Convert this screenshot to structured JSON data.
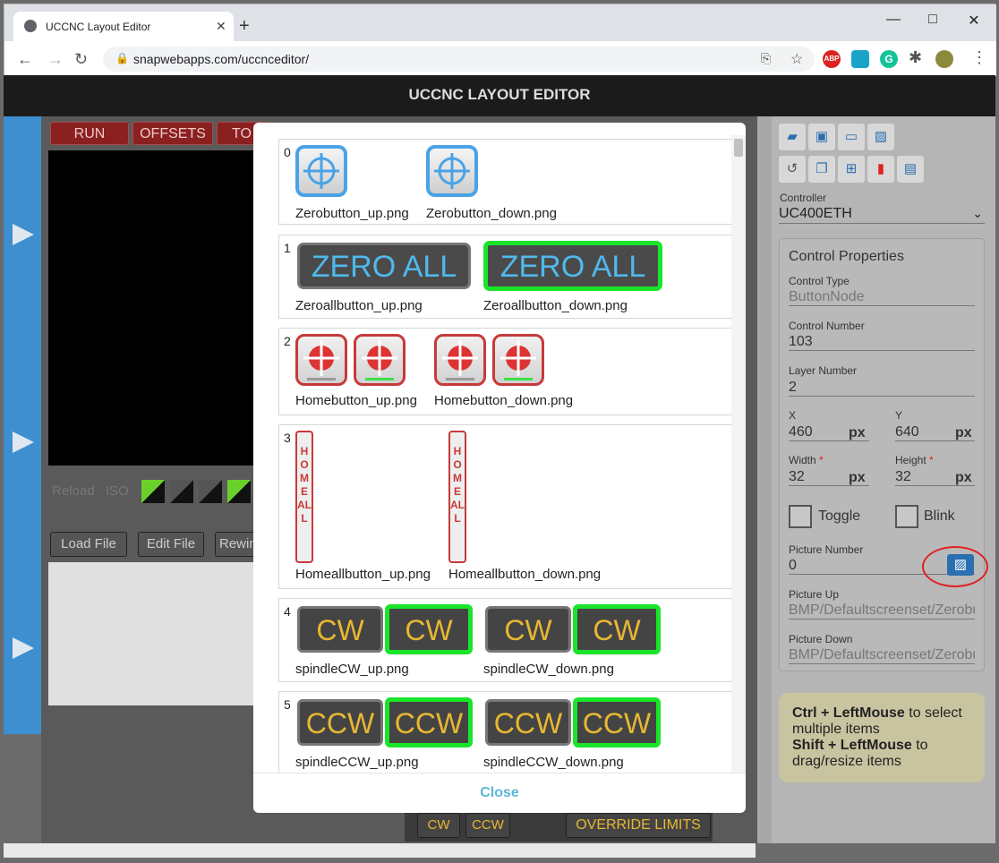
{
  "browser": {
    "tab_title": "UCCNC Layout Editor",
    "url": "snapwebapps.com/uccnceditor/",
    "minimize": "—",
    "maximize": "□",
    "close": "✕",
    "tab_close": "✕",
    "new_tab": "+",
    "ext_abp": "ABP",
    "ext_g": "G"
  },
  "app": {
    "title": "UCCNC LAYOUT EDITOR"
  },
  "toolbar": {
    "run": "RUN",
    "offsets": "OFFSETS",
    "to": "TO",
    "load_file": "Load File",
    "edit_file": "Edit File",
    "rewind": "Rewin",
    "reload": "Reload",
    "iso": "ISO"
  },
  "bottom": {
    "cw": "CW",
    "ccw": "CCW",
    "override": "OVERRIDE LIMITS"
  },
  "panel": {
    "controller_label": "Controller",
    "controller_value": "UC400ETH",
    "section_title": "Control Properties",
    "control_type_label": "Control Type",
    "control_type_value": "ButtonNode",
    "control_number_label": "Control Number",
    "control_number_value": "103",
    "layer_number_label": "Layer Number",
    "layer_number_value": "2",
    "x_label": "X",
    "x_value": "460",
    "y_label": "Y",
    "y_value": "640",
    "width_label": "Width",
    "width_value": "32",
    "height_label": "Height",
    "height_value": "32",
    "unit": "px",
    "required": "*",
    "toggle_label": "Toggle",
    "blink_label": "Blink",
    "picture_number_label": "Picture Number",
    "picture_number_value": "0",
    "picture_up_label": "Picture Up",
    "picture_up_value": "BMP/Defaultscreenset/Zerobu",
    "picture_down_label": "Picture Down",
    "picture_down_value": "BMP/Defaultscreenset/Zerobu"
  },
  "hint": {
    "k1": "Ctrl + LeftMouse",
    "t1": " to select multiple items",
    "k2": "Shift + LeftMouse",
    "t2": " to drag/resize items"
  },
  "modal": {
    "close": "Close",
    "items": [
      {
        "index": "0",
        "up": "Zerobutton_up.png",
        "down": "Zerobutton_down.png"
      },
      {
        "index": "1",
        "up": "Zeroallbutton_up.png",
        "down": "Zeroallbutton_down.png",
        "label": "ZERO ALL"
      },
      {
        "index": "2",
        "up": "Homebutton_up.png",
        "down": "Homebutton_down.png"
      },
      {
        "index": "3",
        "up": "Homeallbutton_up.png",
        "down": "Homeallbutton_down.png",
        "label": "HOME ALL"
      },
      {
        "index": "4",
        "up": "spindleCW_up.png",
        "down": "spindleCW_down.png",
        "label": "CW"
      },
      {
        "index": "5",
        "up": "spindleCCW_up.png",
        "down": "spindleCCW_down.png",
        "label": "CCW"
      }
    ]
  },
  "colors": {
    "accent": "#3d8fd0",
    "green_frame": "#19e52a",
    "red": "#c73a3a",
    "spindle_text": "#e8b732"
  }
}
